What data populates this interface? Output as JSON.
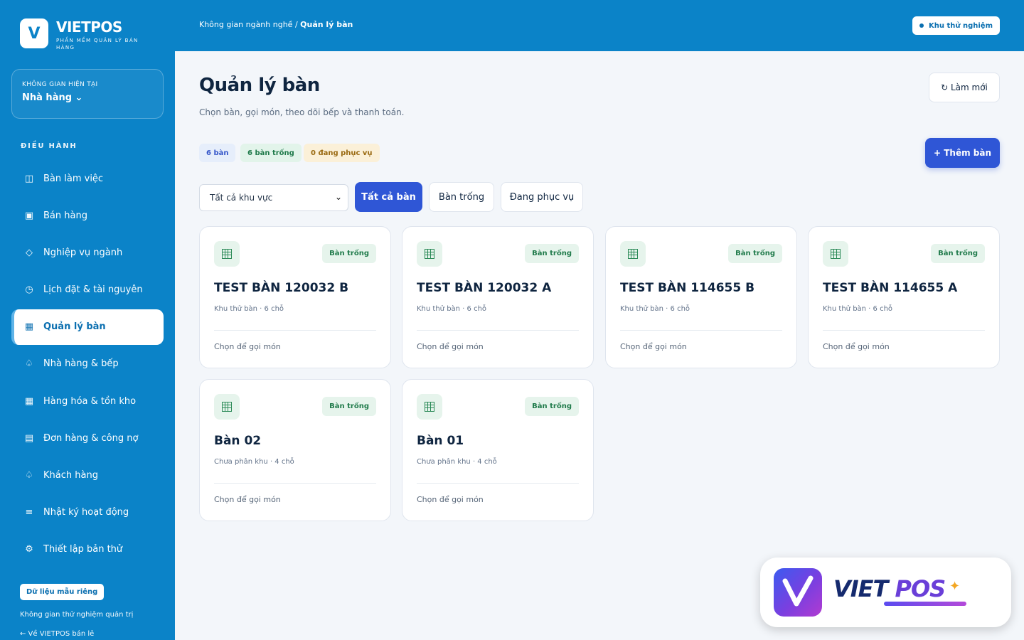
{
  "brand": {
    "logo_letter": "V",
    "name": "VIETPOS",
    "tagline": "PHẦN MỀM QUẢN LÝ BÁN HÀNG"
  },
  "space": {
    "label": "KHÔNG GIAN HIỆN TẠI",
    "value": "Nhà hàng ⌄"
  },
  "sidebar": {
    "section": "ĐIỀU HÀNH",
    "items": [
      {
        "label": "Bàn làm việc",
        "icon": "◫",
        "active": false
      },
      {
        "label": "Bán hàng",
        "icon": "▣",
        "active": false
      },
      {
        "label": "Nghiệp vụ ngành",
        "icon": "◇",
        "active": false
      },
      {
        "label": "Lịch đặt & tài nguyên",
        "icon": "◷",
        "active": false
      },
      {
        "label": "Quản lý bàn",
        "icon": "▦",
        "active": true
      },
      {
        "label": "Nhà hàng & bếp",
        "icon": "♤",
        "active": false
      },
      {
        "label": "Hàng hóa & tồn kho",
        "icon": "▦",
        "active": false
      },
      {
        "label": "Đơn hàng & công nợ",
        "icon": "▤",
        "active": false
      },
      {
        "label": "Khách hàng",
        "icon": "♤",
        "active": false
      },
      {
        "label": "Nhật ký hoạt động",
        "icon": "≡",
        "active": false
      },
      {
        "label": "Thiết lập bản thử",
        "icon": "⚙",
        "active": false
      }
    ],
    "sample_button": "Dữ liệu mẫu riêng",
    "note": "Không gian thử nghiệm quản trị",
    "back_link": "← Về VIETPOS bán lẻ"
  },
  "topbar": {
    "breadcrumb_parent": "Không gian ngành nghề /",
    "breadcrumb_current": "Quản lý bàn",
    "trial_pill": "Khu thử nghiệm"
  },
  "main": {
    "title": "Quản lý bàn",
    "subtitle": "Chọn bàn, gọi món, theo dõi bếp và thanh toán.",
    "refresh": "↻ Làm mới",
    "add": "+ Thêm bàn",
    "stats": {
      "total": "6 bàn",
      "free": "6 bàn trống",
      "serving": "0 đang phục vụ"
    },
    "area_select": "Tất cả khu vực",
    "filters": [
      "Tất cả bàn",
      "Bàn trống",
      "Đang phục vụ"
    ]
  },
  "tables": [
    {
      "name": "TEST BÀN 120032 B",
      "meta": "Khu thử bàn · 6 chỗ",
      "status": "Bàn trống",
      "cta": "Chọn để gọi món"
    },
    {
      "name": "TEST BÀN 120032 A",
      "meta": "Khu thử bàn · 6 chỗ",
      "status": "Bàn trống",
      "cta": "Chọn để gọi món"
    },
    {
      "name": "TEST BÀN 114655 B",
      "meta": "Khu thử bàn · 6 chỗ",
      "status": "Bàn trống",
      "cta": "Chọn để gọi món"
    },
    {
      "name": "TEST BÀN 114655 A",
      "meta": "Khu thử bàn · 6 chỗ",
      "status": "Bàn trống",
      "cta": "Chọn để gọi món"
    },
    {
      "name": "Bàn 02",
      "meta": "Chưa phân khu · 4 chỗ",
      "status": "Bàn trống",
      "cta": "Chọn để gọi món"
    },
    {
      "name": "Bàn 01",
      "meta": "Chưa phân khu · 4 chỗ",
      "status": "Bàn trống",
      "cta": "Chọn để gọi món"
    }
  ],
  "watermark": {
    "word1": "VIET",
    "word2": "POS"
  },
  "colors": {
    "primary": "#0b83c8",
    "accent": "#2f56d6",
    "status_free": "#1f7a4a"
  }
}
